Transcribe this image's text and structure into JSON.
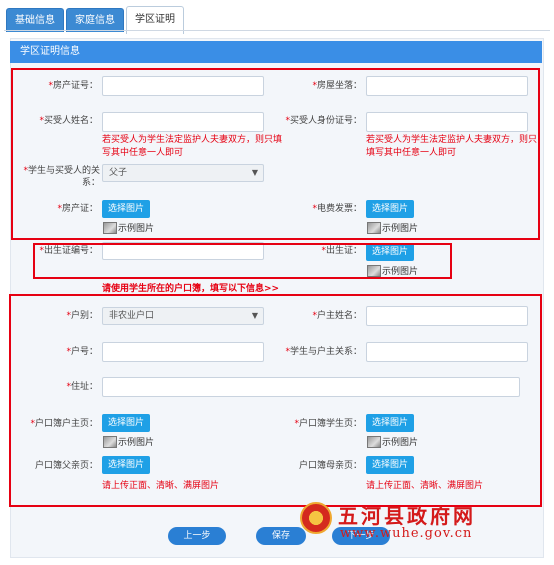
{
  "tabs": [
    {
      "label": "基础信息"
    },
    {
      "label": "家庭信息"
    },
    {
      "label": "学区证明"
    }
  ],
  "section_title": "学区证明信息",
  "property": {
    "cert_no_label": "房产证号：",
    "address_label": "房屋坐落：",
    "buyer_name_label": "买受人姓名：",
    "buyer_id_label": "买受人身份证号：",
    "buyer_hint": "若买受人为学生法定监护人夫妻双方，则只填写其中任意一人即可",
    "relation_label": "学生与买受人的关系：",
    "relation_value": "父子",
    "cert_label": "房产证：",
    "bill_label": "电费发票："
  },
  "birth": {
    "cert_no_label": "出生证编号：",
    "cert_label": "出生证："
  },
  "notice": "请使用学生所在的户口簿，填写以下信息>>",
  "household": {
    "type_label": "户别：",
    "type_value": "非农业户口",
    "head_name_label": "户主姓名：",
    "no_label": "户号：",
    "relation_label": "学生与户主关系：",
    "address_label": "住址：",
    "head_page_label": "户口簿户主页：",
    "student_page_label": "户口簿学生页：",
    "father_page_label": "户口簿父亲页：",
    "mother_page_label": "户口簿母亲页：",
    "upload_hint": "请上传正面、清晰、满屏图片"
  },
  "common": {
    "pick_image": "选择图片",
    "sample_image": "示例图片",
    "required_mark": "*"
  },
  "buttons": {
    "prev": "上一步",
    "save": "保存",
    "next": "下一步"
  },
  "watermark": {
    "title": "五河县政府网",
    "url": "www.wuhe.gov.cn"
  },
  "colors": {
    "accent": "#3a8ee6",
    "button": "#1fa0e6",
    "warning": "#e60012"
  }
}
